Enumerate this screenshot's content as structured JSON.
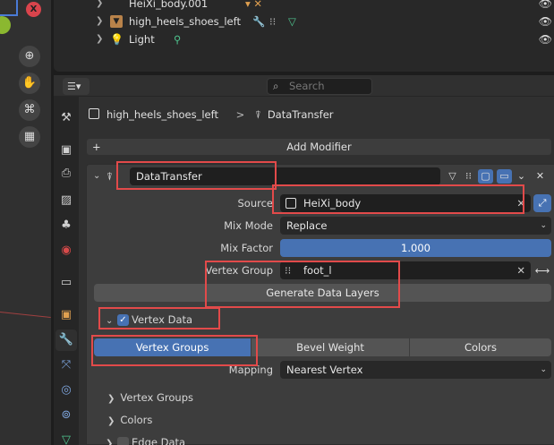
{
  "viewport": {
    "axis_x_label": "X",
    "tools": [
      "zoom-icon",
      "hand-icon",
      "camera-icon",
      "grid-icon"
    ]
  },
  "outliner": {
    "rows": [
      {
        "label": "HeiXi_body.001",
        "icon": "mesh-object-icon"
      },
      {
        "label": "high_heels_shoes_left",
        "icon": "mesh-object-icon"
      },
      {
        "label": "Light",
        "icon": "light-icon"
      }
    ]
  },
  "properties": {
    "search": {
      "placeholder": "Search"
    },
    "breadcrumb": {
      "object": "high_heels_shoes_left",
      "sep": ">",
      "modifier": "DataTransfer"
    },
    "add_modifier_label": "Add Modifier",
    "modifier": {
      "name": "DataTransfer",
      "source_label": "Source",
      "source_value": "HeiXi_body",
      "mix_mode_label": "Mix Mode",
      "mix_mode_value": "Replace",
      "mix_factor_label": "Mix Factor",
      "mix_factor_value": "1.000",
      "mix_factor_fraction": 1.0,
      "vertex_group_label": "Vertex Group",
      "vertex_group_value": "foot_l",
      "generate_button": "Generate Data Layers",
      "vertex_data_label": "Vertex Data",
      "vertex_data_enabled": true,
      "data_types": [
        "Vertex Groups",
        "Bevel Weight",
        "Colors"
      ],
      "active_data_type": "Vertex Groups",
      "mapping_label": "Mapping",
      "mapping_value": "Nearest Vertex",
      "subpanels": [
        "Vertex Groups",
        "Colors"
      ],
      "edge_data_label": "Edge Data",
      "edge_data_enabled": false
    }
  },
  "colors": {
    "accent": "#4772b3",
    "highlight_box": "#e24a4a"
  }
}
